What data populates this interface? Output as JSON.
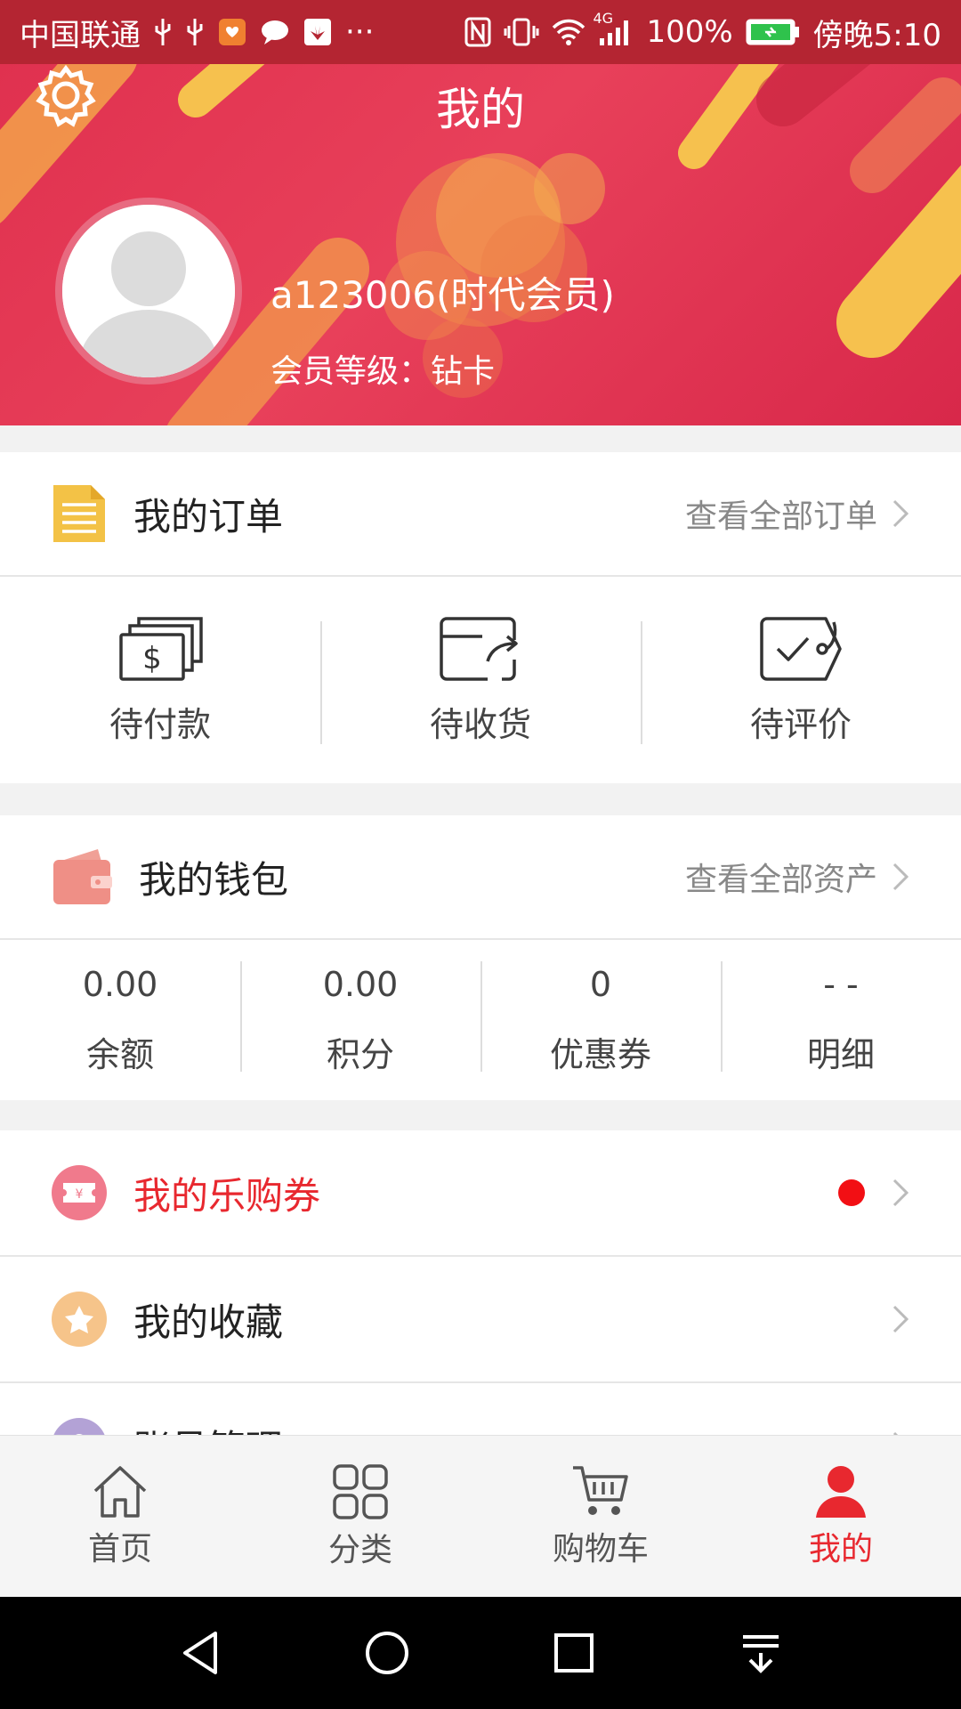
{
  "status_bar": {
    "carrier": "中国联通",
    "network": "4G",
    "battery": "100%",
    "time": "傍晚5:10"
  },
  "header": {
    "title": "我的",
    "username": "a123006(时代会员)",
    "member_level": "会员等级：钻卡"
  },
  "orders": {
    "title": "我的订单",
    "link": "查看全部订单",
    "items": [
      {
        "label": "待付款",
        "icon": "cash-stack-icon"
      },
      {
        "label": "待收货",
        "icon": "delivery-box-icon"
      },
      {
        "label": "待评价",
        "icon": "review-tag-icon"
      }
    ]
  },
  "wallet": {
    "title": "我的钱包",
    "link": "查看全部资产",
    "items": [
      {
        "value": "0.00",
        "label": "余额"
      },
      {
        "value": "0.00",
        "label": "积分"
      },
      {
        "value": "0",
        "label": "优惠券"
      },
      {
        "value": "- -",
        "label": "明细"
      }
    ]
  },
  "menu": {
    "coupon": "我的乐购券",
    "favorites": "我的收藏",
    "account": "账号管理"
  },
  "tabbar": {
    "items": [
      {
        "label": "首页"
      },
      {
        "label": "分类"
      },
      {
        "label": "购物车"
      },
      {
        "label": "我的"
      }
    ]
  },
  "colors": {
    "accent": "#e8282f",
    "header": "#e0314f",
    "coupon_text": "#e8282f"
  }
}
